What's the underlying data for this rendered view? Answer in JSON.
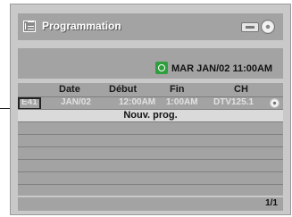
{
  "header": {
    "title": "Programmation",
    "menu_icon": "list-menu-icon",
    "device_icons": [
      "vcr-icon",
      "disc-icon"
    ]
  },
  "status": {
    "datetime": "MAR JAN/02 11:00AM",
    "icon": "timer-clock-icon",
    "icon_color": "#2e9e3e"
  },
  "columns": [
    "Date",
    "Début",
    "Fin",
    "CH"
  ],
  "program_row": {
    "number": "E41",
    "date": "JAN/02",
    "start": "12:00AM",
    "end": "1:00AM",
    "channel": "DTV125.1",
    "media_icon": "disc-icon"
  },
  "new_program_label": "Nouv. prog.",
  "footer": {
    "page": "1/1"
  }
}
